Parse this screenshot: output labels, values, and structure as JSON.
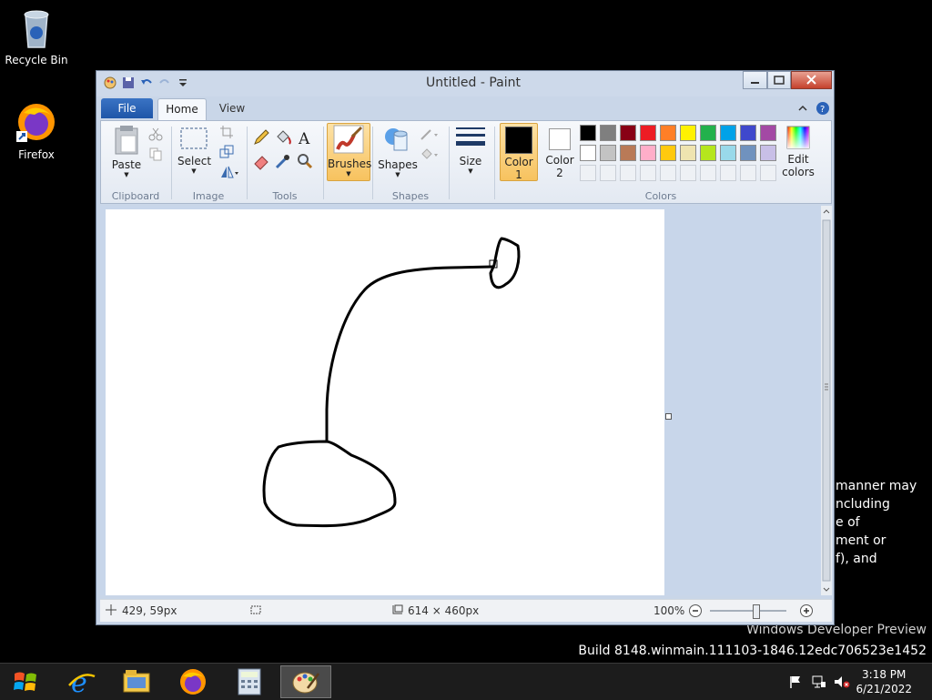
{
  "desktop": {
    "icons": [
      {
        "label": "Recycle Bin",
        "icon": "recycle-bin-icon"
      },
      {
        "label": "Firefox",
        "icon": "firefox-icon"
      }
    ],
    "background_text": [
      "manner may",
      "ncluding",
      "e of",
      "ment or",
      "f), and"
    ],
    "watermark": {
      "line1": "Windows Developer Preview",
      "line2": "Build 8148.winmain.111103-1846.12edc706523e1452"
    }
  },
  "window": {
    "title": "Untitled - Paint",
    "tabs": [
      {
        "label": "File"
      },
      {
        "label": "Home"
      },
      {
        "label": "View"
      }
    ],
    "ribbon": {
      "groups": {
        "clipboard": "Clipboard",
        "image": "Image",
        "tools": "Tools",
        "shapes": "Shapes",
        "colors": "Colors"
      },
      "paste": "Paste",
      "select": "Select",
      "brushes": "Brushes",
      "shapes_btn": "Shapes",
      "size": "Size",
      "color1": {
        "label": "Color",
        "sub": "1",
        "value": "#000000"
      },
      "color2": {
        "label": "Color",
        "sub": "2",
        "value": "#ffffff"
      },
      "edit_colors": {
        "line1": "Edit",
        "line2": "colors"
      },
      "palette_row1": [
        "#000000",
        "#7f7f7f",
        "#880015",
        "#ed1c24",
        "#ff7f27",
        "#fff200",
        "#22b14c",
        "#00a2e8",
        "#3f48cc",
        "#a349a4"
      ],
      "palette_row2": [
        "#ffffff",
        "#c3c3c3",
        "#b97a57",
        "#ffaec9",
        "#ffc90e",
        "#efe4b0",
        "#b5e61d",
        "#99d9ea",
        "#7092be",
        "#c8bfe7"
      ]
    },
    "status": {
      "cursor_pos": "429, 59px",
      "image_size": "614 × 460px",
      "zoom": "100%",
      "zoom_level": 1.0
    }
  },
  "taskbar": {
    "apps": [
      "start-orb-icon",
      "internet-explorer-icon",
      "file-explorer-icon",
      "firefox-icon",
      "calculator-icon",
      "paint-icon"
    ],
    "time": "3:18 PM",
    "date": "6/21/2022"
  }
}
